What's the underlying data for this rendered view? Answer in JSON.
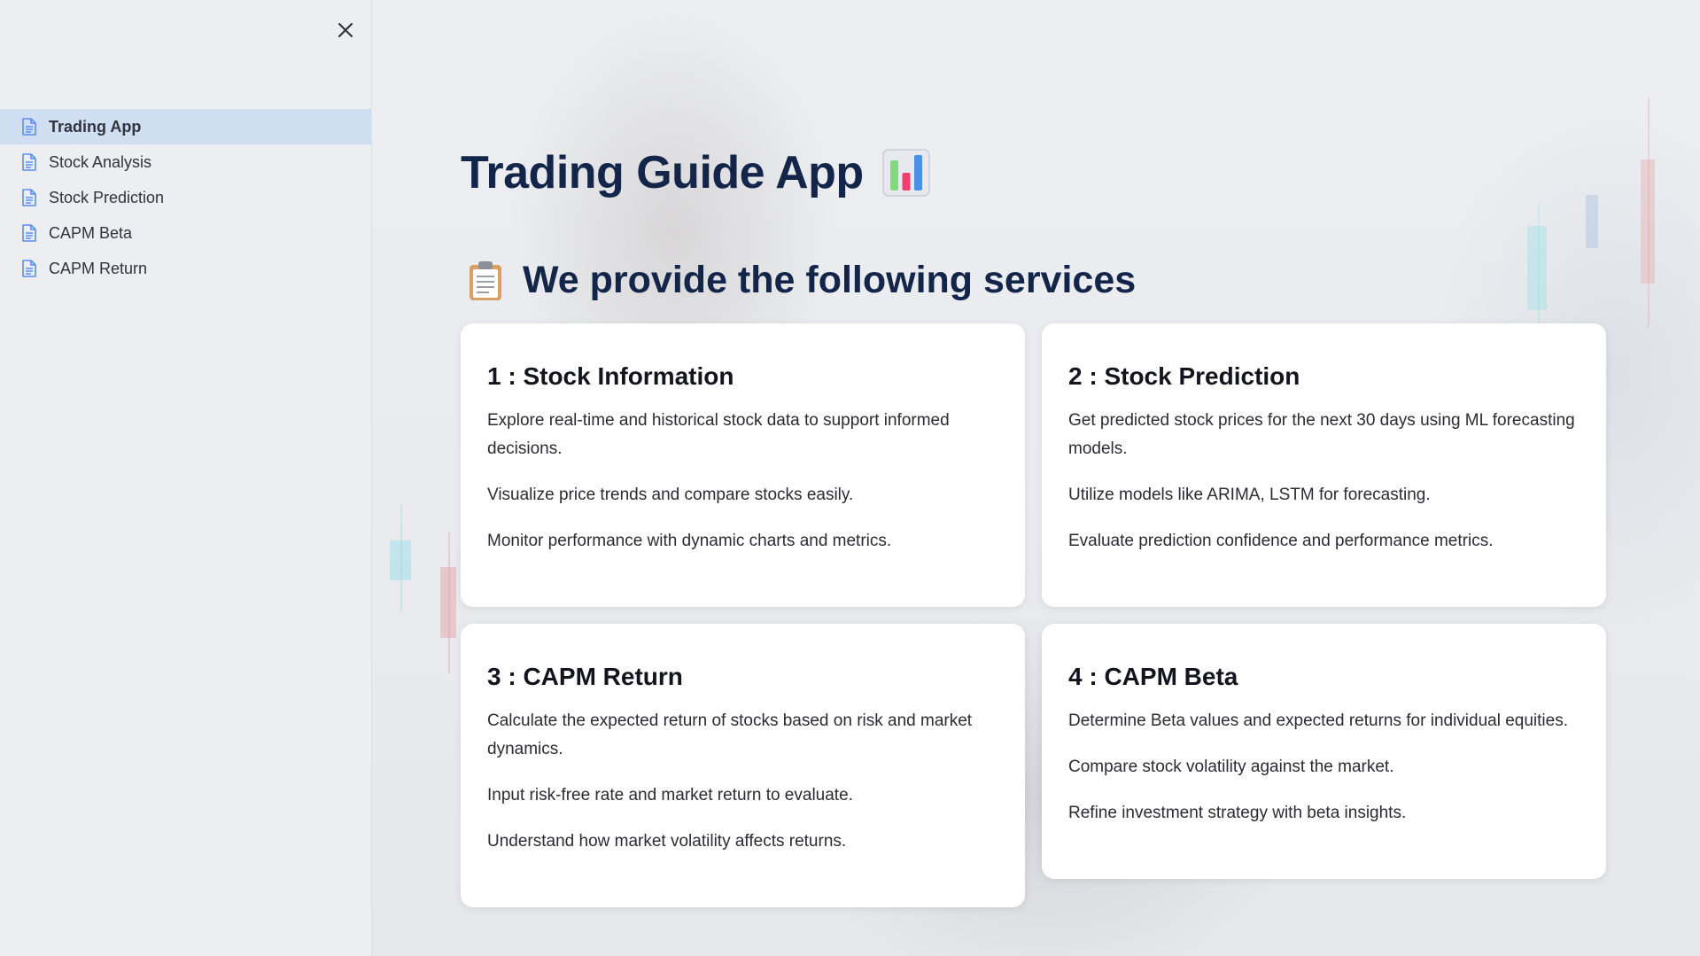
{
  "sidebar": {
    "close_icon": "close-icon",
    "items": [
      {
        "label": "Trading App",
        "icon": "page-icon",
        "active": true
      },
      {
        "label": "Stock Analysis",
        "icon": "page-icon",
        "active": false
      },
      {
        "label": "Stock Prediction",
        "icon": "page-icon",
        "active": false
      },
      {
        "label": "CAPM Beta",
        "icon": "page-icon",
        "active": false
      },
      {
        "label": "CAPM Return",
        "icon": "page-icon",
        "active": false
      }
    ]
  },
  "main": {
    "title": "Trading Guide App",
    "title_icon": "bar-chart-icon",
    "subtitle": "We provide the following services",
    "subtitle_icon": "clipboard-icon",
    "cards": [
      {
        "title": "1 : Stock Information",
        "lines": [
          "Explore real-time and historical stock data to support informed decisions.",
          "Visualize price trends and compare stocks easily.",
          "Monitor performance with dynamic charts and metrics."
        ]
      },
      {
        "title": "2 : Stock Prediction",
        "lines": [
          "Get predicted stock prices for the next 30 days using ML forecasting models.",
          "Utilize models like ARIMA, LSTM for forecasting.",
          "Evaluate prediction confidence and performance metrics."
        ]
      },
      {
        "title": "3 : CAPM Return",
        "lines": [
          "Calculate the expected return of stocks based on risk and market dynamics.",
          "Input risk-free rate and market return to evaluate.",
          "Understand how market volatility affects returns."
        ]
      },
      {
        "title": "4 : CAPM Beta",
        "lines": [
          "Determine Beta values and expected returns for individual equities.",
          "Compare stock volatility against the market.",
          "Refine investment strategy with beta insights."
        ]
      }
    ]
  },
  "colors": {
    "title": "#14254a",
    "nav_active_bg": "#cddcf2",
    "nav_icon": "#5b8def"
  }
}
